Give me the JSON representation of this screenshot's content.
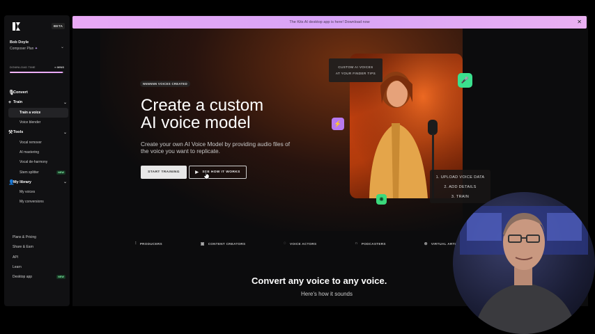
{
  "sidebar": {
    "beta": "BETA",
    "user_name": "Bob Doyle",
    "user_plan": "Composer Plan",
    "download_label": "DOWNLOAD TIME",
    "download_mins": "∞ MINS",
    "download_progress": 0.98,
    "nav": [
      {
        "label": "Convert",
        "icon": "mic-icon"
      },
      {
        "label": "Train",
        "icon": "plus-icon"
      },
      {
        "label": "Train a voice"
      },
      {
        "label": "Voice blender"
      },
      {
        "label": "Tools",
        "icon": "tools-icon"
      },
      {
        "label": "Vocal remover"
      },
      {
        "label": "AI mastering"
      },
      {
        "label": "Vocal de-harmony"
      },
      {
        "label": "Stem splitter",
        "badge": "NEW"
      },
      {
        "label": "My library",
        "icon": "user-icon"
      },
      {
        "label": "My voices"
      },
      {
        "label": "My conversions"
      }
    ],
    "bottom": [
      {
        "label": "Plans & Pricing"
      },
      {
        "label": "Share & Earn"
      },
      {
        "label": "API"
      },
      {
        "label": "Learn"
      },
      {
        "label": "Desktop app",
        "badge": "NEW"
      }
    ]
  },
  "banner": {
    "text": "The Kits AI desktop app is here! Download now",
    "close": "✕"
  },
  "hero": {
    "pill": "NNNNNN VOICES CREATED",
    "title_line1": "Create a custom",
    "title_line2": "AI voice model",
    "desc": "Create your own AI Voice Model by providing audio files of the voice you want to replicate.",
    "start_training": "START TRAINING",
    "see_how": "SEE HOW IT WORKS"
  },
  "visual": {
    "finder_line1": "CUSTOM AI VOICES",
    "finder_line2": "AT YOUR FINDER TIPS",
    "steps": [
      "1. UPLOAD VOICE DATA",
      "2. ADD DETAILS",
      "3. TRAIN"
    ]
  },
  "categories": [
    {
      "label": "PRODUCERS",
      "icon": "sliders-icon"
    },
    {
      "label": "CONTENT CREATORS",
      "icon": "film-icon"
    },
    {
      "label": "VOICE ACTORS",
      "icon": "speech-icon"
    },
    {
      "label": "PODCASTERS",
      "icon": "headphones-icon"
    },
    {
      "label": "VIRTUAL ARTISTS",
      "icon": "globe-icon"
    }
  ],
  "section": {
    "title": "Convert any voice to any voice.",
    "subtitle": "Here's how it sounds"
  },
  "colors": {
    "banner": "#e0a7f5",
    "mic_badge": "#3be08e",
    "bolt_badge": "#b779f0",
    "new_badge": "#7ef0a7"
  }
}
